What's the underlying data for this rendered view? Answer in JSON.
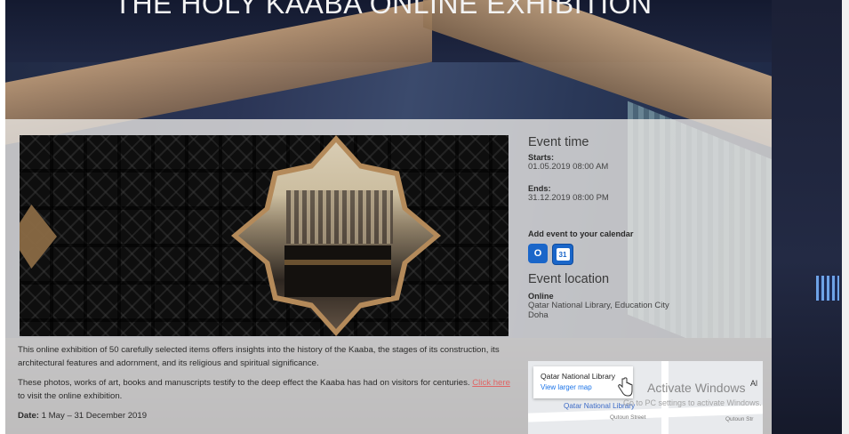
{
  "page": {
    "title": "THE HOLY KAABA ONLINE EXHIBITION"
  },
  "description": {
    "paragraph1": "This online exhibition of 50 carefully selected items offers insights into the history of the Kaaba, the stages of its construction, its architectural features and adornment, and its religious and spiritual significance.",
    "paragraph2_before": "These photos, works of art, books and manuscripts testify to the deep effect the Kaaba has had on visitors for centuries. ",
    "paragraph2_link": "Click here",
    "paragraph2_after": " to visit the online exhibition.",
    "date_label": "Date:",
    "date_value": " 1 May – 31 December 2019"
  },
  "event_time": {
    "heading": "Event time",
    "starts_label": "Starts:",
    "starts_value": "01.05.2019 08:00 AM",
    "ends_label": "Ends:",
    "ends_value": "31.12.2019 08:00 PM"
  },
  "calendar": {
    "label": "Add event to your calendar",
    "outlook_icon_text": "O",
    "gcal_icon_text": "31"
  },
  "event_location": {
    "heading": "Event location",
    "type": "Online",
    "line1": "Qatar National Library, Education City",
    "line2": "Doha"
  },
  "map": {
    "place_name": "Qatar National Library",
    "view_larger": "View larger map",
    "pin_label": "Qatar National Library",
    "street1": "Qutoun Street",
    "street2": "Qutoun Str",
    "corner": "Al"
  },
  "overlay": {
    "activate_title": "Activate Windows",
    "activate_sub": "Go to PC settings to activate Windows."
  },
  "icons": {
    "outlook": "outlook-calendar-icon",
    "google": "google-calendar-icon",
    "cursor": "hand-cursor-icon"
  }
}
